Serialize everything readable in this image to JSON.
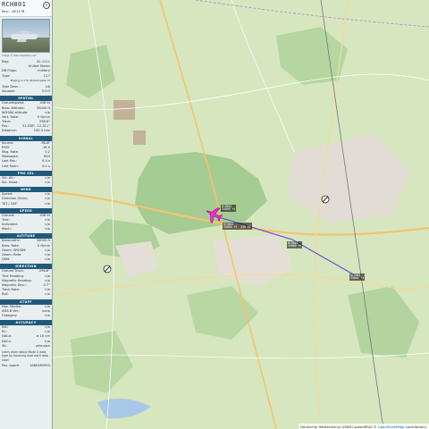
{
  "aircraft": {
    "callsign": "RCH801",
    "hex_label": "Hex: AE117B",
    "photo_caption": "Image © PlaneSpotters.net"
  },
  "info": {
    "reg_label": "Reg:",
    "reg_value": "02-1111",
    "country_value": "United States",
    "db_flags_label": "DB Flags:",
    "db_flags_value": "military",
    "type_label": "Type:",
    "type_value": "C17",
    "type_name": "Boeing C-17A Globemaster III",
    "type_desc_label": "Type Desc.:",
    "type_desc_value": "L4J",
    "squawk_label": "Squawk:",
    "squawk_value": "5123"
  },
  "sections": {
    "spatial": "SPATIAL",
    "signal": "SIGNAL",
    "fms_sel": "FMS SEL",
    "wind": "WIND",
    "speed": "SPEED",
    "altitude": "ALTITUDE",
    "direction": "DIRECTION",
    "stuff": "STUFF",
    "accuracy": "ACCURACY"
  },
  "spatial": [
    {
      "label": "Groundspeed:",
      "value": "438 kt"
    },
    {
      "label": "Baro. Altitude:",
      "value": "34000 ft"
    },
    {
      "label": "WGS84 altitude:",
      "value": "n/a"
    },
    {
      "label": "Vert. Rate:",
      "value": "0 ft/min"
    },
    {
      "label": "Track:",
      "value": "296.6°"
    },
    {
      "label": "Pos.:",
      "value": "51.036°, 12.311°"
    },
    {
      "label": "Distance:",
      "value": "142.3 nmi"
    }
  ],
  "signal": [
    {
      "label": "Source:",
      "value": "MLAT"
    },
    {
      "label": "RSSI:",
      "value": "-18.0"
    },
    {
      "label": "Msg. Rate:",
      "value": "0.2"
    },
    {
      "label": "Messages:",
      "value": "844"
    },
    {
      "label": "Last Pos.:",
      "value": "8.4 s"
    },
    {
      "label": "Last Seen:",
      "value": "8.1 s"
    }
  ],
  "fms_sel": [
    {
      "label": "Sel. Alt.:",
      "value": "n/a"
    },
    {
      "label": "Sel. Head.:",
      "value": "n/a"
    }
  ],
  "wind": [
    {
      "label": "Speed:",
      "value": "n/a"
    },
    {
      "label": "Direction (from):",
      "value": "n/a"
    },
    {
      "label": "TAT / OAT:",
      "value": "n/a"
    }
  ],
  "speed": [
    {
      "label": "Ground:",
      "value": "438 kt"
    },
    {
      "label": "True:",
      "value": "n/a"
    },
    {
      "label": "Indicated:",
      "value": "n/a"
    },
    {
      "label": "Mach:",
      "value": "n/a"
    }
  ],
  "altitude": [
    {
      "label": "Barometric:",
      "value": "34000 ft"
    },
    {
      "label": "Baro. Rate:",
      "value": "0 ft/min"
    },
    {
      "label": "Geom. WGS84:",
      "value": "n/a"
    },
    {
      "label": "Geom. Rate:",
      "value": "n/a"
    },
    {
      "label": "QNH:",
      "value": "n/a"
    }
  ],
  "direction": [
    {
      "label": "Ground Track:",
      "value": "296.6°"
    },
    {
      "label": "True Heading:",
      "value": "n/a"
    },
    {
      "label": "Magnetic Heading:",
      "value": "n/a"
    },
    {
      "label": "Magnetic Decl.:",
      "value": "4.7°"
    },
    {
      "label": "Track Rate:",
      "value": "n/a"
    },
    {
      "label": "Roll:",
      "value": "n/a"
    }
  ],
  "stuff": [
    {
      "label": "Nav. Modes:",
      "value": "n/a"
    },
    {
      "label": "ADS-B Ver.:",
      "value": "none"
    },
    {
      "label": "Category:",
      "value": "n/a"
    }
  ],
  "accuracy": [
    {
      "label": "NIC:",
      "value": "n/a"
    },
    {
      "label": "Rc:",
      "value": "n/a"
    },
    {
      "label": "NACp:",
      "value": "≥ 10 nm"
    },
    {
      "label": "NACv:",
      "value": "n/a"
    },
    {
      "label": "SIL:",
      "value": "unknown"
    }
  ],
  "footer_note": "Learn more about Mode S data type by hovering over each data label",
  "pos_epoch_label": "Pos. epoch:",
  "pos_epoch_value": "1660485993",
  "map": {
    "attribution_prefix": "Deutscher Wetterdienst (DWD) speedRFall ©",
    "attribution_link": "OpenStreetMap",
    "attribution_suffix": "contributors.",
    "labels": {
      "selected": "RCH801\n34000 ft",
      "track1": "RCH801\n34000 ft  438 kt",
      "track2": "RCH801\n34000 ft",
      "track3": "RCH801\n34000 ft"
    },
    "colors": {
      "selected_plane": "#ff2bd6",
      "track_line": "#6a4ed8",
      "forest": "#9cc58a",
      "road": "#f5c36d"
    }
  }
}
